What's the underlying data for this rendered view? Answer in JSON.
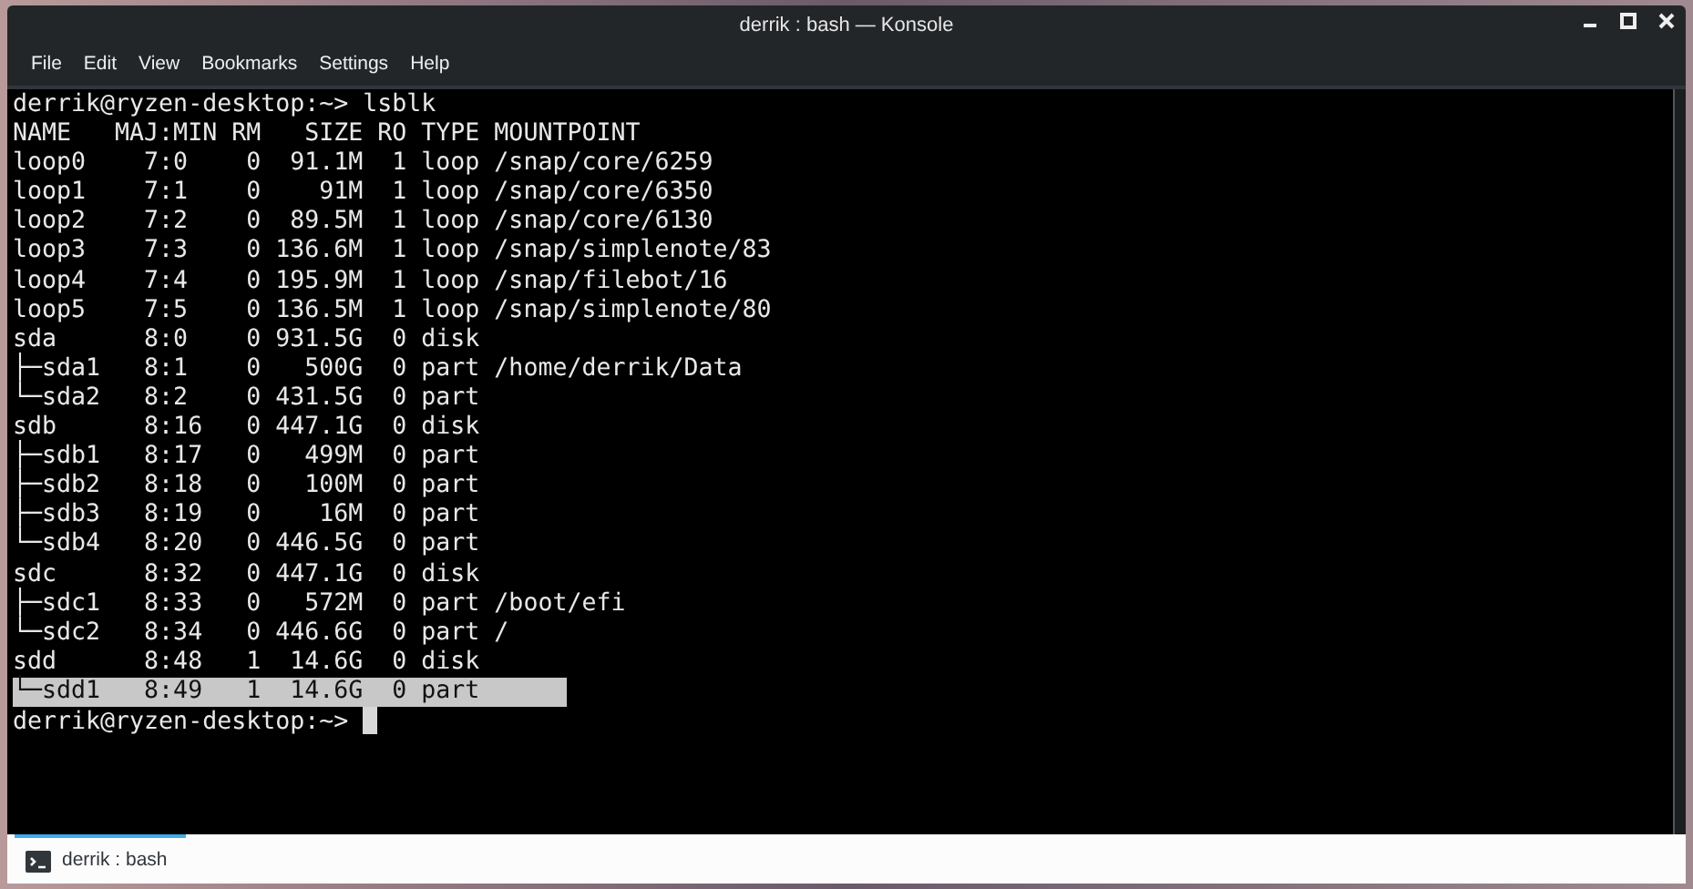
{
  "window": {
    "title": "derrik : bash — Konsole"
  },
  "menu": [
    "File",
    "Edit",
    "View",
    "Bookmarks",
    "Settings",
    "Help"
  ],
  "terminal": {
    "lines": [
      {
        "text": "derrik@ryzen-desktop:~> lsblk",
        "selected": false
      },
      {
        "text": "NAME   MAJ:MIN RM   SIZE RO TYPE MOUNTPOINT",
        "selected": false
      },
      {
        "text": "loop0    7:0    0  91.1M  1 loop /snap/core/6259",
        "selected": false
      },
      {
        "text": "loop1    7:1    0    91M  1 loop /snap/core/6350",
        "selected": false
      },
      {
        "text": "loop2    7:2    0  89.5M  1 loop /snap/core/6130",
        "selected": false
      },
      {
        "text": "loop3    7:3    0 136.6M  1 loop /snap/simplenote/83",
        "selected": false
      },
      {
        "text": "loop4    7:4    0 195.9M  1 loop /snap/filebot/16",
        "selected": false
      },
      {
        "text": "loop5    7:5    0 136.5M  1 loop /snap/simplenote/80",
        "selected": false
      },
      {
        "text": "sda      8:0    0 931.5G  0 disk",
        "selected": false
      },
      {
        "text": "├─sda1   8:1    0   500G  0 part /home/derrik/Data",
        "selected": false
      },
      {
        "text": "└─sda2   8:2    0 431.5G  0 part",
        "selected": false
      },
      {
        "text": "sdb      8:16   0 447.1G  0 disk",
        "selected": false
      },
      {
        "text": "├─sdb1   8:17   0   499M  0 part",
        "selected": false
      },
      {
        "text": "├─sdb2   8:18   0   100M  0 part",
        "selected": false
      },
      {
        "text": "├─sdb3   8:19   0    16M  0 part",
        "selected": false
      },
      {
        "text": "└─sdb4   8:20   0 446.5G  0 part",
        "selected": false
      },
      {
        "text": "sdc      8:32   0 447.1G  0 disk",
        "selected": false
      },
      {
        "text": "├─sdc1   8:33   0   572M  0 part /boot/efi",
        "selected": false
      },
      {
        "text": "└─sdc2   8:34   0 446.6G  0 part /",
        "selected": false
      },
      {
        "text": "sdd      8:48   1  14.6G  0 disk",
        "selected": false
      },
      {
        "text": "└─sdd1   8:49   1  14.6G  0 part",
        "selected": true
      }
    ],
    "prompt": "derrik@ryzen-desktop:~>"
  },
  "tabs": [
    {
      "label": "derrik : bash",
      "selected": true
    }
  ]
}
